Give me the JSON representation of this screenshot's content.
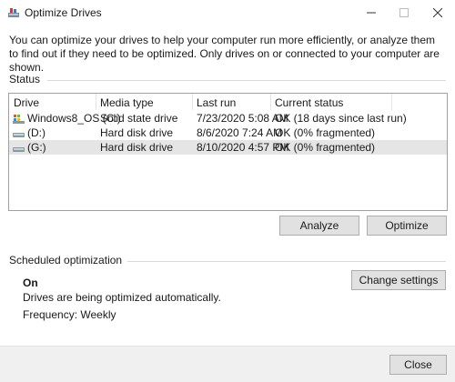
{
  "window": {
    "title": "Optimize Drives"
  },
  "intro_text": "You can optimize your drives to help your computer run more efficiently, or analyze them to find out if they need to be optimized. Only drives on or connected to your computer are shown.",
  "status": {
    "label": "Status",
    "columns": [
      "Drive",
      "Media type",
      "Last run",
      "Current status"
    ],
    "rows": [
      {
        "drive": "Windows8_OS (C:)",
        "icon": "os-drive-icon",
        "media": "Solid state drive",
        "last_run": "7/23/2020 5:08 AM",
        "status": "OK (18 days since last run)"
      },
      {
        "drive": "(D:)",
        "icon": "hard-drive-icon",
        "media": "Hard disk drive",
        "last_run": "8/6/2020 7:24 AM",
        "status": "OK (0% fragmented)"
      },
      {
        "drive": "(G:)",
        "icon": "hard-drive-icon",
        "media": "Hard disk drive",
        "last_run": "8/10/2020 4:57 PM",
        "status": "OK (0% fragmented)",
        "selected": true
      }
    ]
  },
  "buttons": {
    "analyze": "Analyze",
    "optimize": "Optimize",
    "change_settings": "Change settings",
    "close": "Close"
  },
  "scheduled": {
    "label": "Scheduled optimization",
    "state": "On",
    "description": "Drives are being optimized automatically.",
    "frequency": "Frequency: Weekly"
  }
}
